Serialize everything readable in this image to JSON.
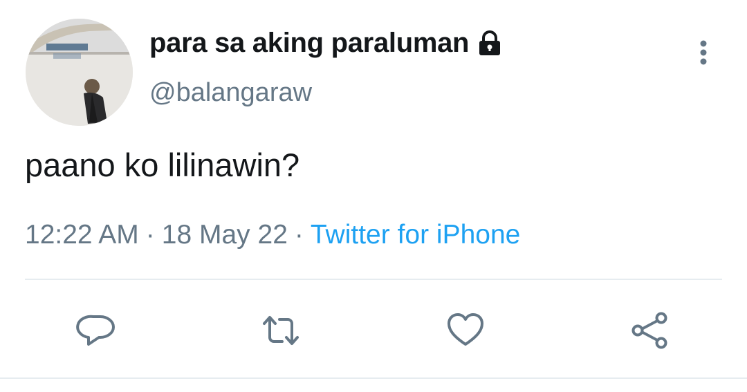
{
  "tweet": {
    "display_name": "para sa aking paraluman",
    "handle": "@balangaraw",
    "text": "paano ko lilinawin?",
    "time": "12:22 AM",
    "date": "18 May 22",
    "source": "Twitter for iPhone",
    "separator": "·"
  },
  "icons": {
    "protected": "lock-icon",
    "more": "more-vertical-icon",
    "reply": "reply-icon",
    "retweet": "retweet-icon",
    "like": "heart-icon",
    "share": "share-icon"
  },
  "colors": {
    "primary_text": "#14171a",
    "secondary_text": "#657786",
    "link": "#1da1f2",
    "divider": "#e6ecf0"
  }
}
